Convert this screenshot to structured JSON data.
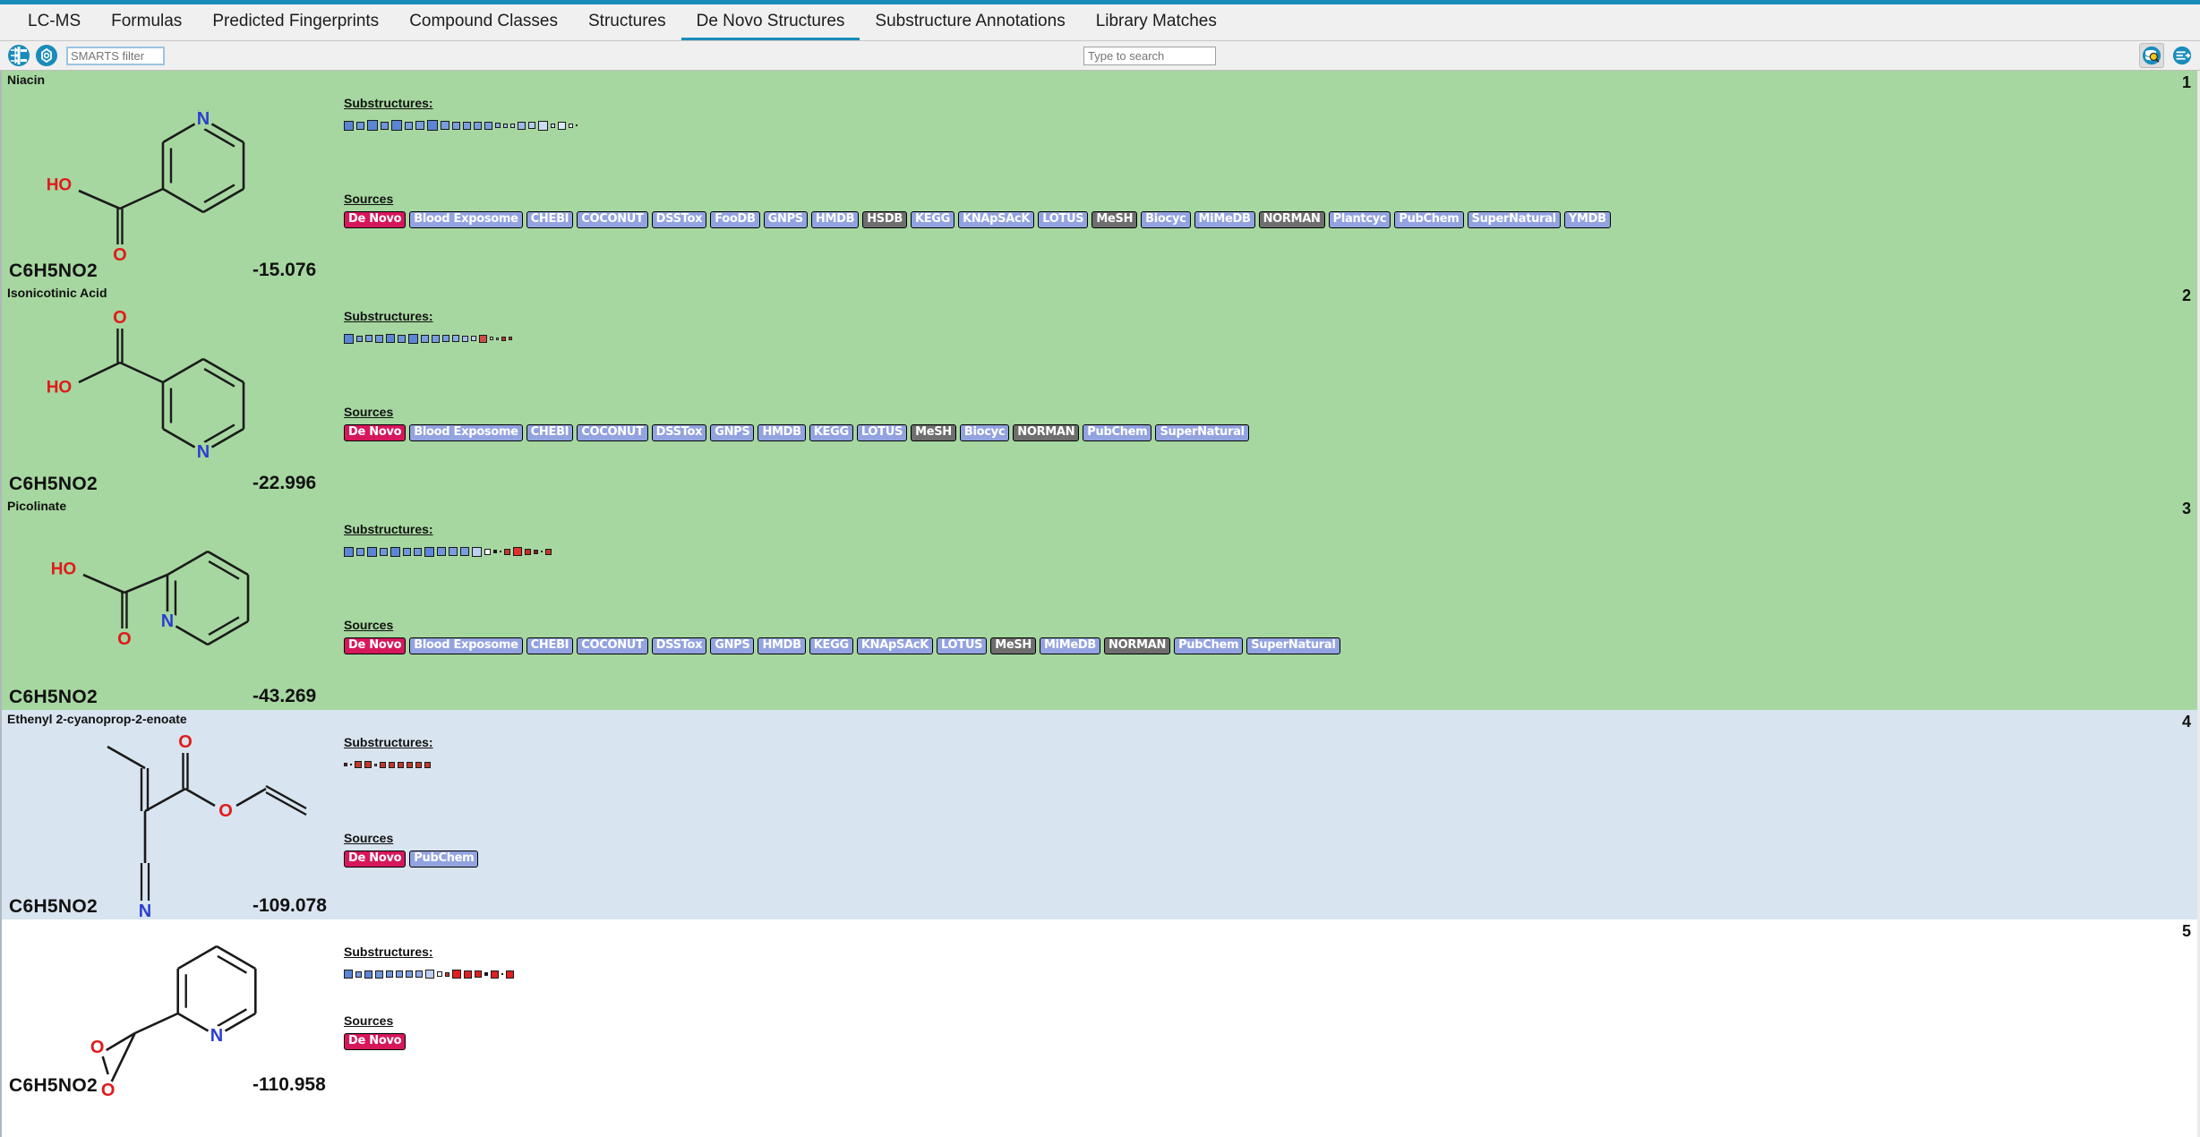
{
  "window": {
    "accent_color": "#1a8cbb"
  },
  "tabs": [
    {
      "label": "LC-MS",
      "active": false
    },
    {
      "label": "Formulas",
      "active": false
    },
    {
      "label": "Predicted Fingerprints",
      "active": false
    },
    {
      "label": "Compound Classes",
      "active": false
    },
    {
      "label": "Structures",
      "active": false
    },
    {
      "label": "De Novo Structures",
      "active": true
    },
    {
      "label": "Substructure Annotations",
      "active": false
    },
    {
      "label": "Library Matches",
      "active": false
    }
  ],
  "toolbar": {
    "smarts_filter_placeholder": "SMARTS filter",
    "smarts_filter_value": "",
    "search_placeholder": "Type to search",
    "search_value": "",
    "icons": {
      "structure_filter": "molecule-filter-icon",
      "substructure": "substructure-icon",
      "database_search": "database-search-icon",
      "export_list": "export-list-icon"
    }
  },
  "labels": {
    "substructures_heading": "Substructures:",
    "sources_heading": "Sources"
  },
  "results": [
    {
      "rank": "1",
      "name": "Niacin",
      "formula": "C6H5NO2",
      "score": "-15.076",
      "selection": "sel-green",
      "structure": "niacin",
      "substructures": [
        {
          "color": "#5b86d6",
          "size": 11
        },
        {
          "color": "#6f95db",
          "size": 9
        },
        {
          "color": "#5b86d6",
          "size": 12
        },
        {
          "color": "#6f95db",
          "size": 9
        },
        {
          "color": "#5b86d6",
          "size": 12
        },
        {
          "color": "#7a9ddf",
          "size": 9
        },
        {
          "color": "#7a9ddf",
          "size": 10
        },
        {
          "color": "#5b86d6",
          "size": 12
        },
        {
          "color": "#7a9ddf",
          "size": 10
        },
        {
          "color": "#7a9ddf",
          "size": 9
        },
        {
          "color": "#7a9ddf",
          "size": 9
        },
        {
          "color": "#7a9ddf",
          "size": 9
        },
        {
          "color": "#7a9ddf",
          "size": 9
        },
        {
          "color": "#8fabe5",
          "size": 6
        },
        {
          "color": "#a8bfec",
          "size": 5
        },
        {
          "color": "#bed0f1",
          "size": 5
        },
        {
          "color": "#9db7e8",
          "size": 9
        },
        {
          "color": "#b6cbf0",
          "size": 8
        },
        {
          "color": "#cddcf6",
          "size": 11
        },
        {
          "color": "#c3d4f3",
          "size": 5
        },
        {
          "color": "#dce7f9",
          "size": 9
        },
        {
          "color": "#ffffff",
          "size": 5
        },
        {
          "color": "#7a9ddf",
          "size": 2
        }
      ],
      "sources": [
        {
          "label": "De Novo",
          "style": "denovo"
        },
        {
          "label": "Blood Exposome",
          "style": "normal"
        },
        {
          "label": "CHEBI",
          "style": "normal"
        },
        {
          "label": "COCONUT",
          "style": "normal"
        },
        {
          "label": "DSSTox",
          "style": "normal"
        },
        {
          "label": "FooDB",
          "style": "normal"
        },
        {
          "label": "GNPS",
          "style": "normal"
        },
        {
          "label": "HMDB",
          "style": "normal"
        },
        {
          "label": "HSDB",
          "style": "grey"
        },
        {
          "label": "KEGG",
          "style": "normal"
        },
        {
          "label": "KNApSAcK",
          "style": "normal"
        },
        {
          "label": "LOTUS",
          "style": "normal"
        },
        {
          "label": "MeSH",
          "style": "grey"
        },
        {
          "label": "Biocyc",
          "style": "normal"
        },
        {
          "label": "MiMeDB",
          "style": "normal"
        },
        {
          "label": "NORMAN",
          "style": "grey"
        },
        {
          "label": "Plantcyc",
          "style": "normal"
        },
        {
          "label": "PubChem",
          "style": "normal"
        },
        {
          "label": "SuperNatural",
          "style": "normal"
        },
        {
          "label": "YMDB",
          "style": "normal"
        }
      ]
    },
    {
      "rank": "2",
      "name": "Isonicotinic Acid",
      "formula": "C6H5NO2",
      "score": "-22.996",
      "selection": "sel-green",
      "structure": "isonicotinic",
      "substructures": [
        {
          "color": "#5b86d6",
          "size": 11
        },
        {
          "color": "#7a9ddf",
          "size": 7
        },
        {
          "color": "#7a9ddf",
          "size": 8
        },
        {
          "color": "#6f95db",
          "size": 9
        },
        {
          "color": "#5b86d6",
          "size": 10
        },
        {
          "color": "#6f95db",
          "size": 9
        },
        {
          "color": "#5b86d6",
          "size": 11
        },
        {
          "color": "#7a9ddf",
          "size": 9
        },
        {
          "color": "#7a9ddf",
          "size": 9
        },
        {
          "color": "#7a9ddf",
          "size": 8
        },
        {
          "color": "#8fabe5",
          "size": 8
        },
        {
          "color": "#a8bfec",
          "size": 7
        },
        {
          "color": "#bed0f1",
          "size": 6
        },
        {
          "color": "#d14b4b",
          "size": 9
        },
        {
          "color": "#e8e8e8",
          "size": 4
        },
        {
          "color": "#d4d4d4",
          "size": 3
        },
        {
          "color": "#c0392b",
          "size": 5
        },
        {
          "color": "#c0392b",
          "size": 4
        }
      ],
      "sources": [
        {
          "label": "De Novo",
          "style": "denovo"
        },
        {
          "label": "Blood Exposome",
          "style": "normal"
        },
        {
          "label": "CHEBI",
          "style": "normal"
        },
        {
          "label": "COCONUT",
          "style": "normal"
        },
        {
          "label": "DSSTox",
          "style": "normal"
        },
        {
          "label": "GNPS",
          "style": "normal"
        },
        {
          "label": "HMDB",
          "style": "normal"
        },
        {
          "label": "KEGG",
          "style": "normal"
        },
        {
          "label": "LOTUS",
          "style": "normal"
        },
        {
          "label": "MeSH",
          "style": "grey"
        },
        {
          "label": "Biocyc",
          "style": "normal"
        },
        {
          "label": "NORMAN",
          "style": "grey"
        },
        {
          "label": "PubChem",
          "style": "normal"
        },
        {
          "label": "SuperNatural",
          "style": "normal"
        }
      ]
    },
    {
      "rank": "3",
      "name": "Picolinate",
      "formula": "C6H5NO2",
      "score": "-43.269",
      "selection": "sel-green",
      "structure": "picolinate",
      "substructures": [
        {
          "color": "#5b86d6",
          "size": 11
        },
        {
          "color": "#6f95db",
          "size": 9
        },
        {
          "color": "#5b86d6",
          "size": 11
        },
        {
          "color": "#6f95db",
          "size": 9
        },
        {
          "color": "#5b86d6",
          "size": 11
        },
        {
          "color": "#6f95db",
          "size": 9
        },
        {
          "color": "#6f95db",
          "size": 9
        },
        {
          "color": "#5b86d6",
          "size": 11
        },
        {
          "color": "#6f95db",
          "size": 10
        },
        {
          "color": "#7a9ddf",
          "size": 10
        },
        {
          "color": "#7a9ddf",
          "size": 10
        },
        {
          "color": "#bed0f1",
          "size": 11
        },
        {
          "color": "#ffffff",
          "size": 7
        },
        {
          "color": "#1a1a1a",
          "size": 4
        },
        {
          "color": "#555555",
          "size": 2
        },
        {
          "color": "#c0392b",
          "size": 7
        },
        {
          "color": "#e03030",
          "size": 10
        },
        {
          "color": "#d12a2a",
          "size": 7
        },
        {
          "color": "#8e2020",
          "size": 5
        },
        {
          "color": "#6b1515",
          "size": 2
        },
        {
          "color": "#c0392b",
          "size": 7
        }
      ],
      "sources": [
        {
          "label": "De Novo",
          "style": "denovo"
        },
        {
          "label": "Blood Exposome",
          "style": "normal"
        },
        {
          "label": "CHEBI",
          "style": "normal"
        },
        {
          "label": "COCONUT",
          "style": "normal"
        },
        {
          "label": "DSSTox",
          "style": "normal"
        },
        {
          "label": "GNPS",
          "style": "normal"
        },
        {
          "label": "HMDB",
          "style": "normal"
        },
        {
          "label": "KEGG",
          "style": "normal"
        },
        {
          "label": "KNApSAcK",
          "style": "normal"
        },
        {
          "label": "LOTUS",
          "style": "normal"
        },
        {
          "label": "MeSH",
          "style": "grey"
        },
        {
          "label": "MiMeDB",
          "style": "normal"
        },
        {
          "label": "NORMAN",
          "style": "grey"
        },
        {
          "label": "PubChem",
          "style": "normal"
        },
        {
          "label": "SuperNatural",
          "style": "normal"
        }
      ]
    },
    {
      "rank": "4",
      "name": "Ethenyl 2-cyanoprop-2-enoate",
      "formula": "C6H5NO2",
      "score": "-109.078",
      "selection": "sel-blue",
      "structure": "ethenyl",
      "substructures": [
        {
          "color": "#7a2020",
          "size": 4
        },
        {
          "color": "#b0b0b0",
          "size": 2
        },
        {
          "color": "#c0392b",
          "size": 8
        },
        {
          "color": "#c0392b",
          "size": 8
        },
        {
          "color": "#9a9a9a",
          "size": 3
        },
        {
          "color": "#c0392b",
          "size": 7
        },
        {
          "color": "#c0392b",
          "size": 7
        },
        {
          "color": "#c0392b",
          "size": 7
        },
        {
          "color": "#c0392b",
          "size": 7
        },
        {
          "color": "#c0392b",
          "size": 7
        },
        {
          "color": "#c0392b",
          "size": 7
        }
      ],
      "sources": [
        {
          "label": "De Novo",
          "style": "denovo"
        },
        {
          "label": "PubChem",
          "style": "normal"
        }
      ]
    },
    {
      "rank": "5",
      "name": "",
      "formula": "C6H5NO2",
      "score": "-110.958",
      "selection": "sel-white",
      "structure": "epoxide",
      "substructures": [
        {
          "color": "#5b86d6",
          "size": 10
        },
        {
          "color": "#7a9ddf",
          "size": 7
        },
        {
          "color": "#5b86d6",
          "size": 9
        },
        {
          "color": "#6f95db",
          "size": 9
        },
        {
          "color": "#6f95db",
          "size": 8
        },
        {
          "color": "#7a9ddf",
          "size": 8
        },
        {
          "color": "#7a9ddf",
          "size": 8
        },
        {
          "color": "#8fabe5",
          "size": 8
        },
        {
          "color": "#bed0f1",
          "size": 10
        },
        {
          "color": "#ffffff",
          "size": 6
        },
        {
          "color": "#c0392b",
          "size": 5
        },
        {
          "color": "#e02020",
          "size": 10
        },
        {
          "color": "#e02020",
          "size": 9
        },
        {
          "color": "#e02020",
          "size": 8
        },
        {
          "color": "#111111",
          "size": 4
        },
        {
          "color": "#e02020",
          "size": 9
        },
        {
          "color": "#888888",
          "size": 2
        },
        {
          "color": "#e02020",
          "size": 9
        }
      ],
      "sources": [
        {
          "label": "De Novo",
          "style": "denovo"
        }
      ]
    }
  ]
}
